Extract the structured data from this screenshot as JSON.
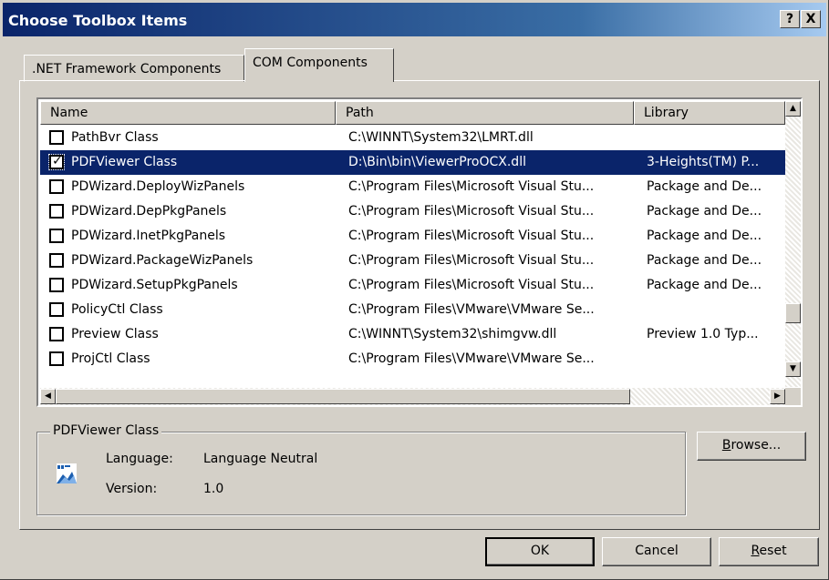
{
  "window": {
    "title": "Choose Toolbox Items",
    "help_glyph": "?",
    "close_glyph": "X"
  },
  "tabs": [
    {
      "label": ".NET Framework Components"
    },
    {
      "label": "COM Components"
    }
  ],
  "list": {
    "columns": [
      "Name",
      "Path",
      "Library"
    ],
    "rows": [
      {
        "name": "PathBvr Class",
        "path": "C:\\WINNT\\System32\\LMRT.dll",
        "library": "",
        "checked": false
      },
      {
        "name": "PDFViewer Class",
        "path": "D:\\Bin\\bin\\ViewerProOCX.dll",
        "library": "3-Heights(TM) P...",
        "checked": true,
        "selected": true
      },
      {
        "name": "PDWizard.DeployWizPanels",
        "path": "C:\\Program Files\\Microsoft Visual Stu...",
        "library": "Package and De...",
        "checked": false
      },
      {
        "name": "PDWizard.DepPkgPanels",
        "path": "C:\\Program Files\\Microsoft Visual Stu...",
        "library": "Package and De...",
        "checked": false
      },
      {
        "name": "PDWizard.InetPkgPanels",
        "path": "C:\\Program Files\\Microsoft Visual Stu...",
        "library": "Package and De...",
        "checked": false
      },
      {
        "name": "PDWizard.PackageWizPanels",
        "path": "C:\\Program Files\\Microsoft Visual Stu...",
        "library": "Package and De...",
        "checked": false
      },
      {
        "name": "PDWizard.SetupPkgPanels",
        "path": "C:\\Program Files\\Microsoft Visual Stu...",
        "library": "Package and De...",
        "checked": false
      },
      {
        "name": "PolicyCtl Class",
        "path": "C:\\Program Files\\VMware\\VMware Se...",
        "library": "",
        "checked": false
      },
      {
        "name": "Preview Class",
        "path": "C:\\WINNT\\System32\\shimgvw.dll",
        "library": "Preview 1.0 Typ...",
        "checked": false
      },
      {
        "name": "ProjCtl Class",
        "path": "C:\\Program Files\\VMware\\VMware Se...",
        "library": "",
        "checked": false
      }
    ]
  },
  "details": {
    "title": "PDFViewer Class",
    "language_label": "Language:",
    "language_value": "Language Neutral",
    "version_label": "Version:",
    "version_value": "1.0",
    "icon": "component-icon"
  },
  "buttons": {
    "browse": "Browse...",
    "ok": "OK",
    "cancel": "Cancel",
    "reset": "Reset"
  },
  "colors": {
    "selection": "#0a246a",
    "face": "#d4d0c8"
  }
}
